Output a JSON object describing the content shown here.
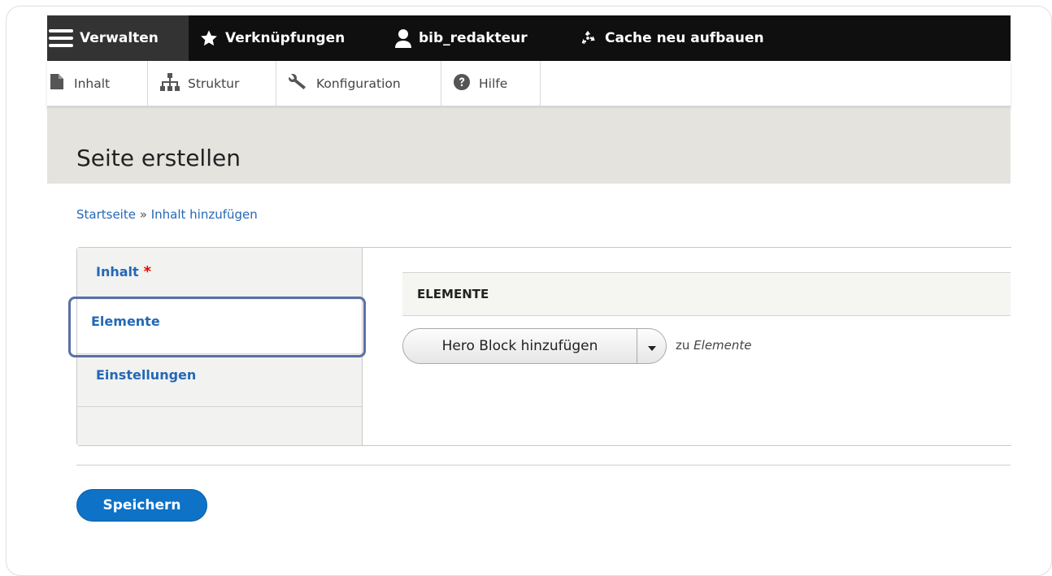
{
  "toolbar": {
    "manage_label": "Verwalten",
    "shortcuts_label": "Verknüpfungen",
    "user_label": "bib_redakteur",
    "cache_label": "Cache neu aufbauen"
  },
  "tray": {
    "tabs": [
      {
        "label": "Inhalt",
        "icon": "file-icon"
      },
      {
        "label": "Struktur",
        "icon": "sitemap-icon"
      },
      {
        "label": "Konfiguration",
        "icon": "wrench-icon"
      },
      {
        "label": "Hilfe",
        "icon": "question-icon"
      }
    ]
  },
  "page": {
    "title": "Seite erstellen"
  },
  "breadcrumb": {
    "items": [
      "Startseite",
      "Inhalt hinzufügen"
    ],
    "separator": "»"
  },
  "vertical_tabs": {
    "items": [
      {
        "label": "Inhalt",
        "required": "*"
      },
      {
        "label": "Elemente"
      },
      {
        "label": "Einstellungen"
      }
    ]
  },
  "elements_pane": {
    "heading": "ELEMENTE",
    "add_button_label": "Hero Block hinzufügen",
    "zu_prefix": "zu",
    "zu_target": "Elemente"
  },
  "actions": {
    "save_label": "Speichern"
  },
  "colors": {
    "toolbar_bg": "#0f0f0f",
    "link": "#2468b6",
    "primary_button": "#0e72c7",
    "required": "#e00000",
    "focus_ring": "#5b6fa8"
  }
}
